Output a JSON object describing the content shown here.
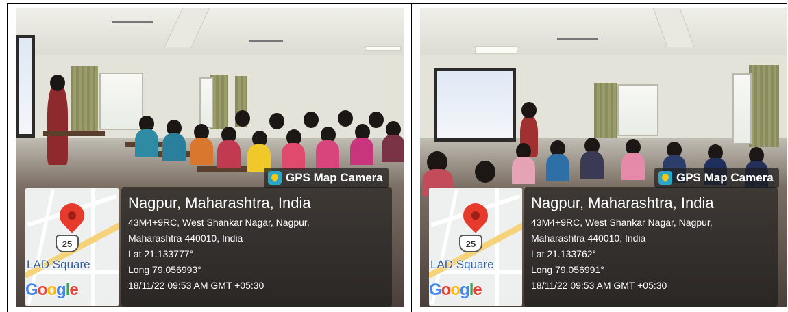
{
  "photos": [
    {
      "gps_label": "GPS Map Camera",
      "map": {
        "place": "LAD Square",
        "route_shield": "25",
        "logo": "Google"
      },
      "info": {
        "city": "Nagpur, Maharashtra, India",
        "address_line1": "43M4+9RC, West Shankar Nagar, Nagpur,",
        "address_line2": "Maharashtra 440010, India",
        "lat": "Lat 21.133777°",
        "long": "Long 79.056993°",
        "timestamp": "18/11/22 09:53 AM GMT +05:30"
      }
    },
    {
      "gps_label": "GPS Map Camera",
      "map": {
        "place": "LAD Square",
        "route_shield": "25",
        "logo": "Google"
      },
      "info": {
        "city": "Nagpur, Maharashtra, India",
        "address_line1": "43M4+9RC, West Shankar Nagar, Nagpur,",
        "address_line2": "Maharashtra 440010, India",
        "lat": "Lat 21.133762°",
        "long": "Long 79.056991°",
        "timestamp": "18/11/22 09:53 AM GMT +05:30"
      }
    }
  ],
  "colors": {
    "pin": "#e53a2c",
    "overlay": "rgba(25,25,25,0.62)",
    "place_text": "#2c5ea8"
  }
}
